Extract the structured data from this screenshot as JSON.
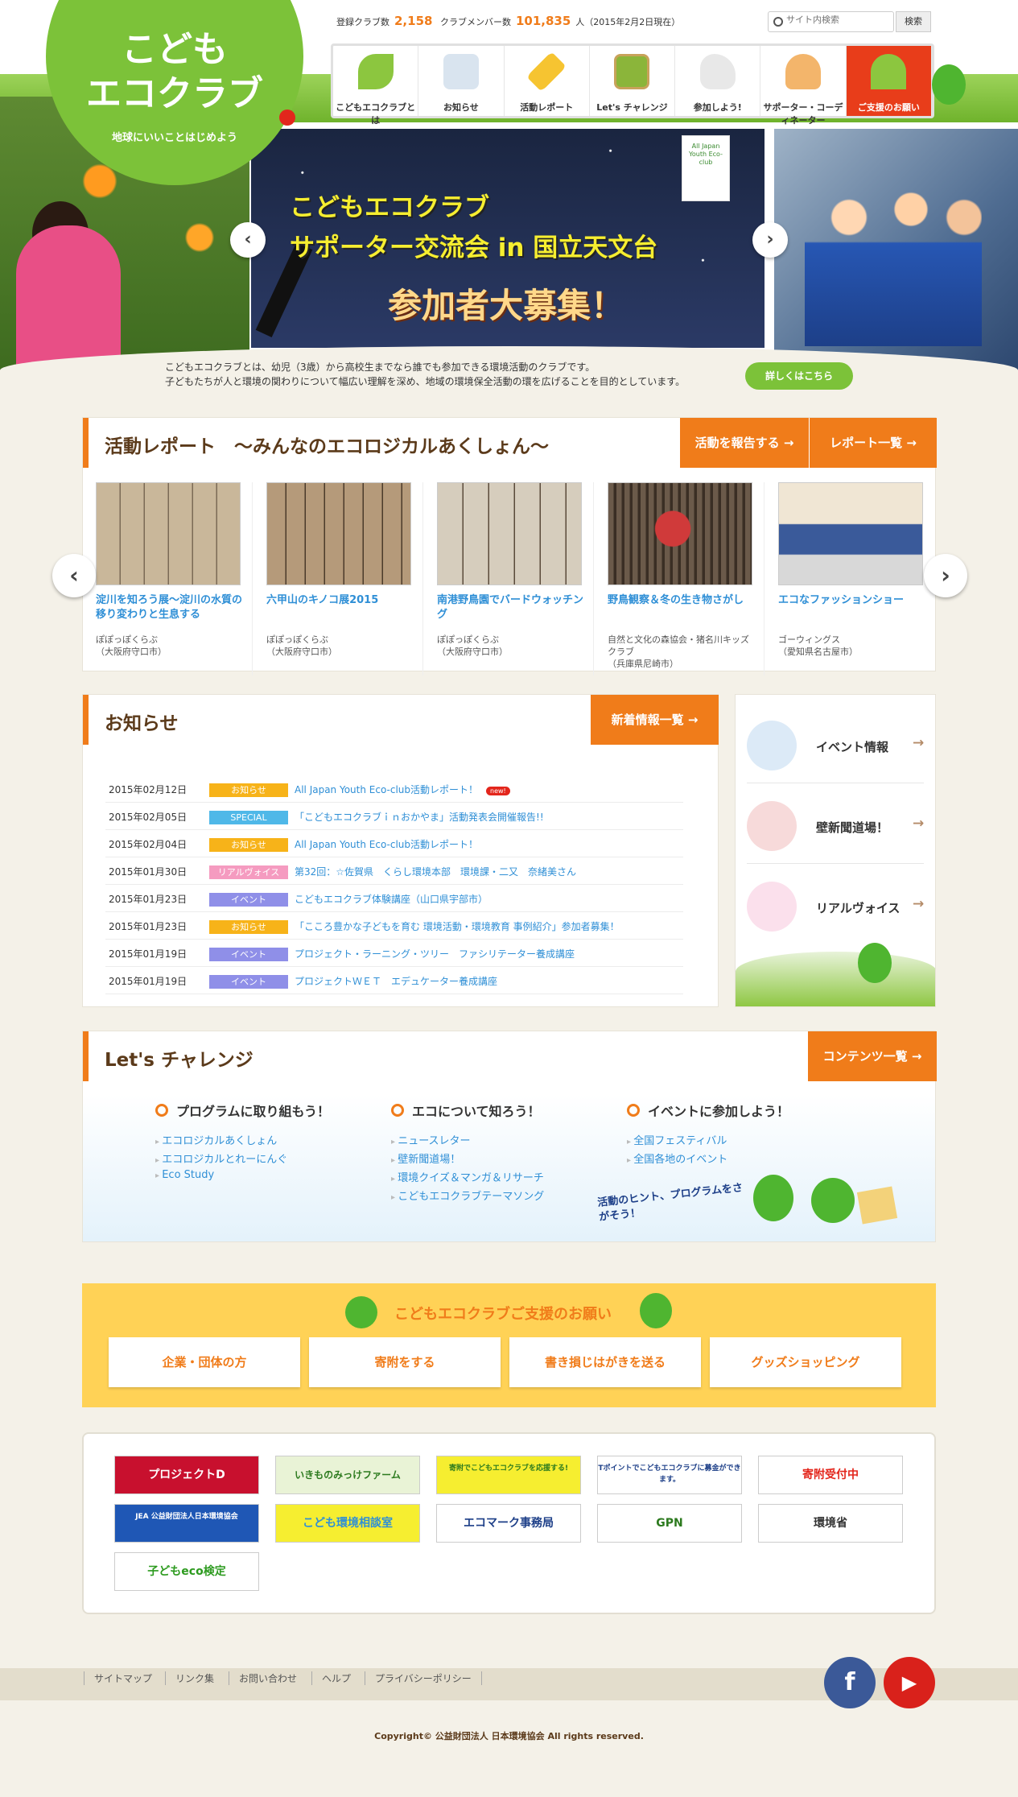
{
  "logo": {
    "line1": "こども",
    "line2": "エコクラブ",
    "tagline": "地球にいいことはじめよう"
  },
  "stats": {
    "clubs_label": "登録クラブ数",
    "clubs_value": "2,158",
    "members_label": "クラブメンバー数",
    "members_value": "101,835",
    "members_unit": "人",
    "as_of": "（2015年2月2日現在）"
  },
  "search": {
    "placeholder": "サイト内検索",
    "button": "検索"
  },
  "gnav": [
    "こどもエコクラブとは",
    "お知らせ",
    "活動レポート",
    "Let's チャレンジ",
    "参加しよう!",
    "サポーター・コーディネーター",
    "ご支援のお願い"
  ],
  "slide": {
    "line1": "こどもエコクラブ",
    "line2": "サポーター交流会 in 国立天文台",
    "line3": "参加者大募集！",
    "badge": "All Japan Youth Eco-club"
  },
  "intro": {
    "line1": "こどもエコクラブとは、幼児（3歳）から高校生まで​なら誰でも参加できる環境活動のクラブです。",
    "line2": "子どもたちが人と環境の関わりについて幅広い理解を深め、地域の環境保全活動の環を広げることを目的としています。",
    "button": "詳しくはこちら"
  },
  "report": {
    "title": "活動レポート　～みんなのエコロジカルあくしょん～",
    "btn_report": "活動を報告する →",
    "btn_list": "レポート一覧 →",
    "cards": [
      {
        "title": "淀川を知ろう展～淀川の水質の移り変わりと生息する",
        "org": "ぽぽっぽくらぶ\n（大阪府守口市）"
      },
      {
        "title": "六甲山のキノコ展2015",
        "org": "ぽぽっぽくらぶ\n（大阪府守口市）"
      },
      {
        "title": "南港野鳥園でバードウォッチング",
        "org": "ぽぽっぽくらぶ\n（大阪府守口市）"
      },
      {
        "title": "野鳥観察＆冬の生き物さがし",
        "org": "自然と文化の森協会・猪名川キッズクラブ\n（兵庫県尼崎市）"
      },
      {
        "title": "エコなファッションショー",
        "org": "ゴーウィングス\n（愛知県名古屋市）"
      }
    ]
  },
  "news": {
    "title": "お知らせ",
    "btn": "新着情報一覧 →",
    "new_badge": "new!",
    "items": [
      {
        "date": "2015年02月12日",
        "cat": "お知らせ",
        "color": "#f7b319",
        "title": "All Japan Youth Eco-club活動レポート！"
      },
      {
        "date": "2015年02月05日",
        "cat": "SPECIAL",
        "color": "#4fb8e8",
        "title": "「こどもエコクラブｉｎおかやま」活動発表会開催報告!!"
      },
      {
        "date": "2015年02月04日",
        "cat": "お知らせ",
        "color": "#f7b319",
        "title": "All Japan Youth Eco-club活動レポート！"
      },
      {
        "date": "2015年01月30日",
        "cat": "リアルヴォイス",
        "color": "#f59bc0",
        "title": "第32回：☆佐賀県　くらし環境本部　環境課・二又　奈緒美さん"
      },
      {
        "date": "2015年01月23日",
        "cat": "イベント",
        "color": "#8f8fe8",
        "title": "こどもエコクラブ体験講座（山口県宇部市）"
      },
      {
        "date": "2015年01月23日",
        "cat": "お知らせ",
        "color": "#f7b319",
        "title": "「こころ豊かな子どもを育む 環境活動・環境教育 事例紹介」参加者募集！"
      },
      {
        "date": "2015年01月19日",
        "cat": "イベント",
        "color": "#8f8fe8",
        "title": "プロジェクト・ラーニング・ツリー　ファシリテーター養成講座"
      },
      {
        "date": "2015年01月19日",
        "cat": "イベント",
        "color": "#8f8fe8",
        "title": "プロジェクトＷＥＴ　エデュケーター養成講座"
      }
    ]
  },
  "side": [
    {
      "label": "イベント情報",
      "color": "#b9d7f0"
    },
    {
      "label": "壁新聞道場！",
      "color": "#f4c9c9"
    },
    {
      "label": "リアルヴォイス",
      "color": "#f9d2e3"
    }
  ],
  "challenge": {
    "title": "Let's チャレンジ",
    "btn": "コンテンツ一覧 →",
    "cols": [
      {
        "head": "プログラムに取り組もう！",
        "links": [
          "エコロジカルあくしょん",
          "エコロジカルとれーにんぐ",
          "Eco Study"
        ]
      },
      {
        "head": "エコについて知ろう！",
        "links": [
          "ニュースレター",
          "壁新聞道場！",
          "環境クイズ＆マンガ＆リサーチ",
          "こどもエコクラブテーマソング"
        ]
      },
      {
        "head": "イベントに参加しよう！",
        "links": [
          "全国フェスティバル",
          "全国各地のイベント"
        ]
      }
    ],
    "hint": "活動のヒント、プログラムをさがそう！"
  },
  "support": {
    "title": "こどもエコクラブご支援のお願い",
    "buttons": [
      "企業・団体の方",
      "寄附をする",
      "書き損じはがきを送る",
      "グッズショッピング"
    ]
  },
  "banners": [
    {
      "label": "プロジェクトD",
      "bg": "#c8102e",
      "fg": "#ffffff"
    },
    {
      "label": "いきものみっけファーム",
      "bg": "#e9f3d6",
      "fg": "#2c7a1e"
    },
    {
      "label": "寄附でこどもエコクラブを応援する!",
      "bg": "#f6ee30",
      "fg": "#2c7a1e"
    },
    {
      "label": "Tポイントでこどもエコクラブに募金ができます。",
      "bg": "#ffffff",
      "fg": "#1d3f88"
    },
    {
      "label": "寄附受付中",
      "bg": "#ffffff",
      "fg": "#e3261c"
    },
    {
      "label": "JEA 公益財団法人日本環境協会",
      "bg": "#1f57b5",
      "fg": "#ffffff"
    },
    {
      "label": "こども環境相談室",
      "bg": "#f6ee30",
      "fg": "#2f8fd6"
    },
    {
      "label": "エコマーク事務局",
      "bg": "#ffffff",
      "fg": "#1d3f88"
    },
    {
      "label": "GPN",
      "bg": "#ffffff",
      "fg": "#2c7a1e"
    },
    {
      "label": "環境省",
      "bg": "#ffffff",
      "fg": "#333333"
    },
    {
      "label": "子どもeco検定",
      "bg": "#ffffff",
      "fg": "#2c9a1e"
    }
  ],
  "footer": {
    "links": [
      "サイトマップ",
      "リンク集",
      "お問い合わせ",
      "ヘルプ",
      "プライバシーポリシー"
    ],
    "copyright": "Copyright© 公益財団法人 日本環境協会 All rights reserved."
  }
}
